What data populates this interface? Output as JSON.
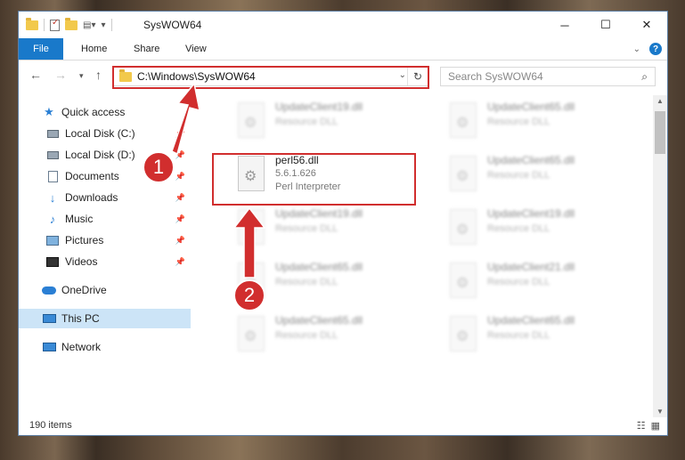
{
  "window": {
    "title": "SysWOW64",
    "controls": {
      "minimize": "─",
      "maximize": "☐",
      "close": "✕"
    }
  },
  "ribbon": {
    "tabs": [
      "File",
      "Home",
      "Share",
      "View"
    ],
    "expand_icon": "chevron-down-icon",
    "help_label": "?"
  },
  "nav": {
    "address": "C:\\Windows\\SysWOW64",
    "search_placeholder": "Search SysWOW64"
  },
  "sidebar": {
    "items": [
      {
        "label": "Quick access",
        "icon": "star-icon"
      },
      {
        "label": "Local Disk (C:)",
        "icon": "drive-icon",
        "pinned": true
      },
      {
        "label": "Local Disk (D:)",
        "icon": "drive-icon",
        "pinned": true
      },
      {
        "label": "Documents",
        "icon": "document-icon",
        "pinned": true
      },
      {
        "label": "Downloads",
        "icon": "download-icon",
        "pinned": true
      },
      {
        "label": "Music",
        "icon": "music-icon",
        "pinned": true
      },
      {
        "label": "Pictures",
        "icon": "pictures-icon",
        "pinned": true
      },
      {
        "label": "Videos",
        "icon": "videos-icon",
        "pinned": true
      },
      {
        "label": "OneDrive",
        "icon": "cloud-icon"
      },
      {
        "label": "This PC",
        "icon": "computer-icon",
        "selected": true
      },
      {
        "label": "Network",
        "icon": "network-icon"
      }
    ]
  },
  "files": {
    "highlighted": {
      "name": "perl56.dll",
      "version": "5.6.1.626",
      "description": "Perl Interpreter"
    },
    "blurred": [
      {
        "name": "UpdateClient19.dll",
        "description": "Resource DLL"
      },
      {
        "name": "UpdateClient65.dll",
        "description": "Resource DLL"
      },
      {
        "name": "UpdateClient65.dll",
        "description": "Resource DLL"
      },
      {
        "name": "UpdateClient19.dll",
        "description": "Resource DLL"
      },
      {
        "name": "UpdateClient19.dll",
        "description": "Resource DLL"
      },
      {
        "name": "UpdateClient65.dll",
        "description": "Resource DLL"
      },
      {
        "name": "UpdateClient21.dll",
        "description": "Resource DLL"
      },
      {
        "name": "UpdateClient65.dll",
        "description": "Resource DLL"
      },
      {
        "name": "UpdateClient65.dll",
        "description": "Resource DLL"
      }
    ]
  },
  "status": {
    "items_count": "190 items"
  },
  "annotations": {
    "step1": "1",
    "step2": "2",
    "color": "#d12e2e"
  }
}
